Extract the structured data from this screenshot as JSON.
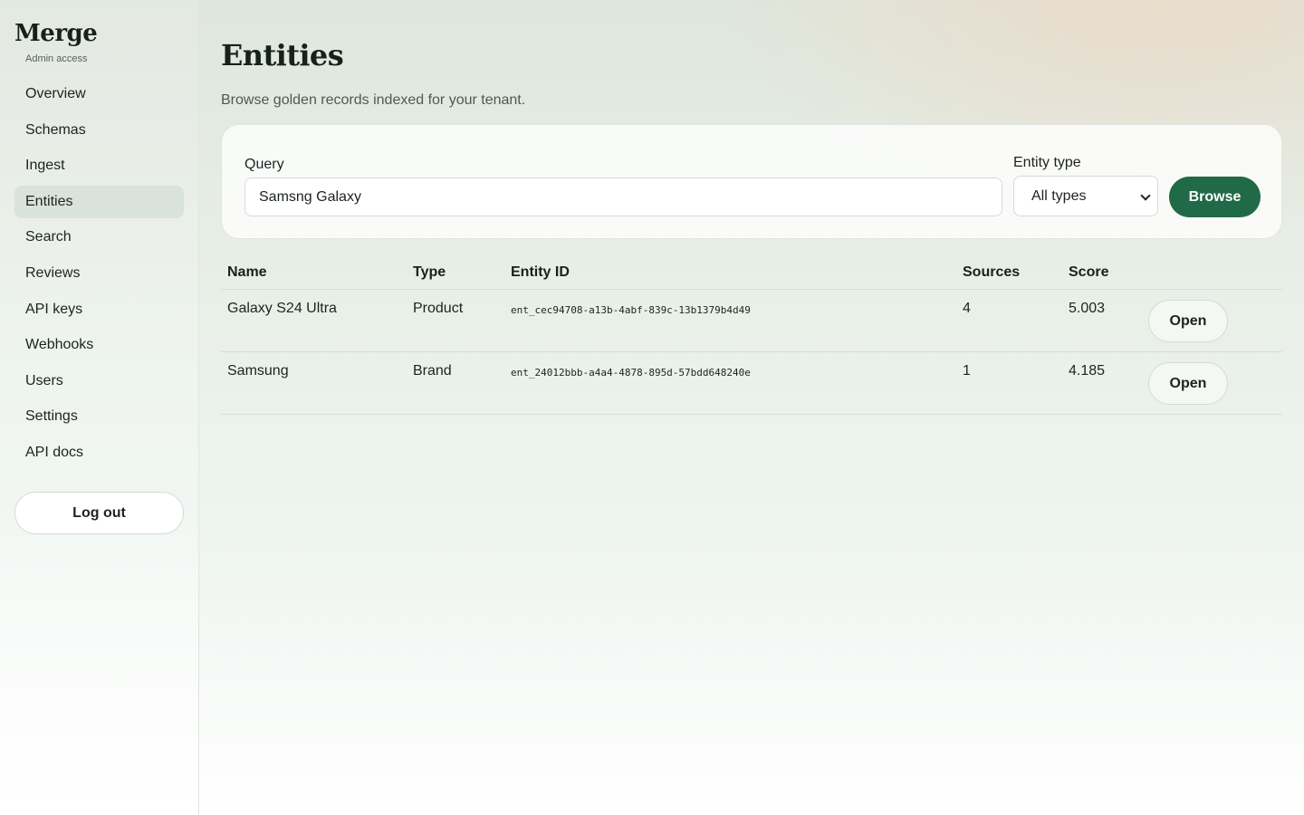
{
  "app": {
    "brand": "Merge",
    "access_level": "Admin access"
  },
  "sidebar": {
    "items": [
      {
        "label": "Overview",
        "active": false
      },
      {
        "label": "Schemas",
        "active": false
      },
      {
        "label": "Ingest",
        "active": false
      },
      {
        "label": "Entities",
        "active": true
      },
      {
        "label": "Search",
        "active": false
      },
      {
        "label": "Reviews",
        "active": false
      },
      {
        "label": "API keys",
        "active": false
      },
      {
        "label": "Webhooks",
        "active": false
      },
      {
        "label": "Users",
        "active": false
      },
      {
        "label": "Settings",
        "active": false
      },
      {
        "label": "API docs",
        "active": false
      }
    ],
    "logout_label": "Log out"
  },
  "page": {
    "title": "Entities",
    "subtitle": "Browse golden records indexed for your tenant."
  },
  "filters": {
    "query_label": "Query",
    "query_value": "Samsng Galaxy",
    "entity_type_label": "Entity type",
    "entity_type_selected": "All types",
    "browse_label": "Browse"
  },
  "table": {
    "columns": [
      "Name",
      "Type",
      "Entity ID",
      "Sources",
      "Score"
    ],
    "rows": [
      {
        "name": "Galaxy S24 Ultra",
        "type": "Product",
        "entity_id": "ent_cec94708-a13b-4abf-839c-13b1379b4d49",
        "sources": "4",
        "score": "5.003",
        "action": "Open"
      },
      {
        "name": "Samsung",
        "type": "Brand",
        "entity_id": "ent_24012bbb-a4a4-4878-895d-57bdd648240e",
        "sources": "1",
        "score": "4.185",
        "action": "Open"
      }
    ]
  },
  "colors": {
    "accent": "#216a48",
    "active_nav_bg": "#d9e2dc"
  }
}
